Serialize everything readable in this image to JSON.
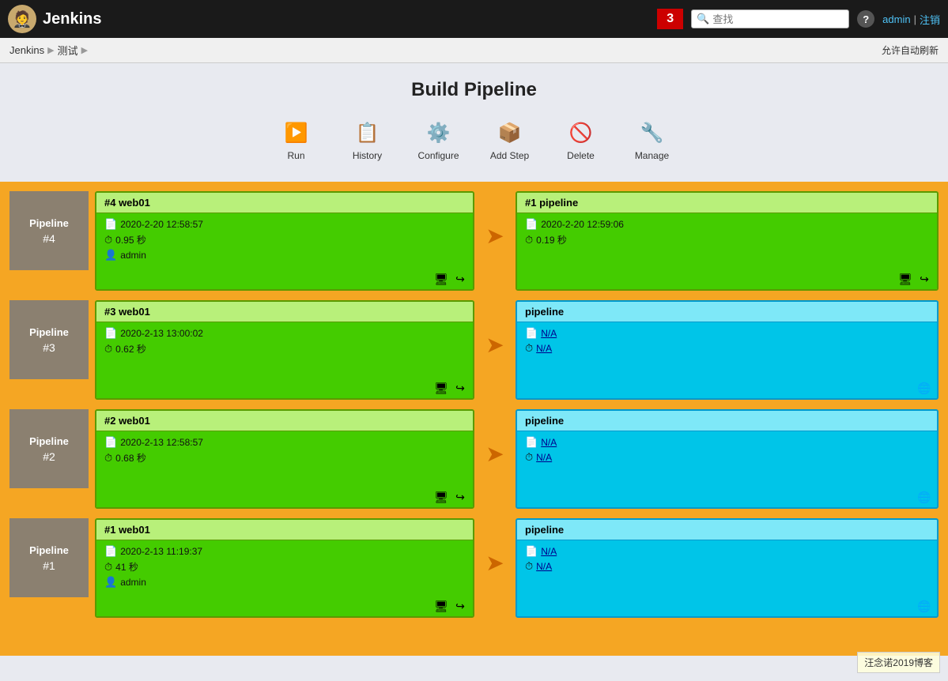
{
  "header": {
    "logo_text": "Jenkins",
    "notification_count": "3",
    "search_placeholder": "查找",
    "help_label": "?",
    "user_name": "admin",
    "logout_label": "注销"
  },
  "breadcrumb": {
    "jenkins_label": "Jenkins",
    "test_label": "测试",
    "auto_refresh": "允许自动刷新"
  },
  "page": {
    "title": "Build Pipeline"
  },
  "toolbar": {
    "run_label": "Run",
    "history_label": "History",
    "configure_label": "Configure",
    "add_step_label": "Add Step",
    "delete_label": "Delete",
    "manage_label": "Manage"
  },
  "pipelines": [
    {
      "id": "row4",
      "label_title": "Pipeline",
      "label_num": "#4",
      "left_card": {
        "header": "#4 web01",
        "date": "2020-2-20 12:58:57",
        "duration": "0.95 秒",
        "user": "admin",
        "has_user": true
      },
      "right_card": {
        "header": "#1 pipeline",
        "date": "2020-2-20 12:59:06",
        "duration": "0.19 秒",
        "has_user": false,
        "is_green": true,
        "is_na": false
      }
    },
    {
      "id": "row3",
      "label_title": "Pipeline",
      "label_num": "#3",
      "left_card": {
        "header": "#3 web01",
        "date": "2020-2-13 13:00:02",
        "duration": "0.62 秒",
        "user": "",
        "has_user": false
      },
      "right_card": {
        "header": "pipeline",
        "date": "N/A",
        "duration": "N/A",
        "has_user": false,
        "is_green": false,
        "is_na": true
      }
    },
    {
      "id": "row2",
      "label_title": "Pipeline",
      "label_num": "#2",
      "left_card": {
        "header": "#2 web01",
        "date": "2020-2-13 12:58:57",
        "duration": "0.68 秒",
        "user": "",
        "has_user": false
      },
      "right_card": {
        "header": "pipeline",
        "date": "N/A",
        "duration": "N/A",
        "has_user": false,
        "is_green": false,
        "is_na": true
      }
    },
    {
      "id": "row1",
      "label_title": "Pipeline",
      "label_num": "#1",
      "left_card": {
        "header": "#1 web01",
        "date": "2020-2-13 11:19:37",
        "duration": "41 秒",
        "user": "admin",
        "has_user": true
      },
      "right_card": {
        "header": "pipeline",
        "date": "N/A",
        "duration": "N/A",
        "has_user": false,
        "is_green": false,
        "is_na": true
      }
    }
  ],
  "watermark": "汪念诺2019博客"
}
